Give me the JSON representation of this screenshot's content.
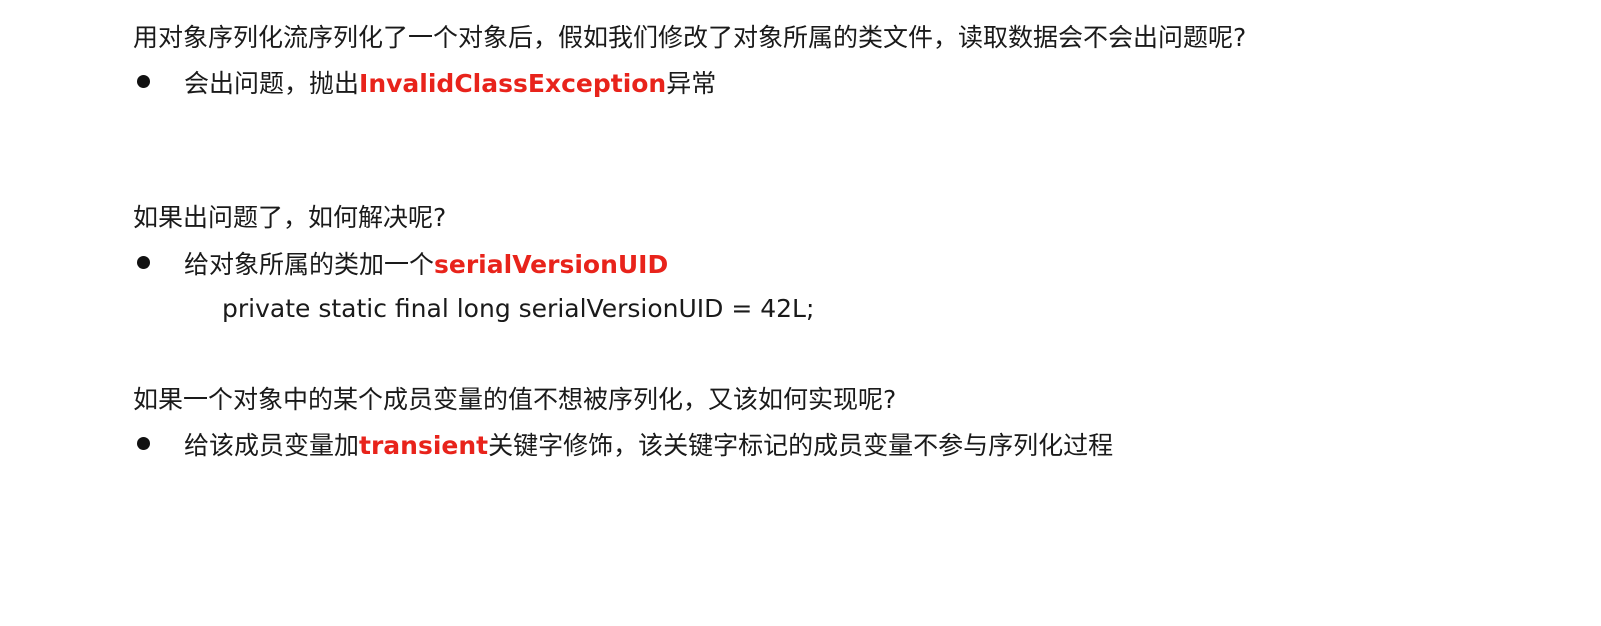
{
  "section1": {
    "question": "用对象序列化流序列化了一个对象后，假如我们修改了对象所属的类文件，读取数据会不会出问题呢?",
    "bullet_pre": "会出问题，抛出",
    "bullet_hl": "InvalidClassException",
    "bullet_post": "异常"
  },
  "section2": {
    "question": "如果出问题了，如何解决呢?",
    "bullet_pre": "给对象所属的类加一个",
    "bullet_hl": "serialVersionUID",
    "code": "private static final long serialVersionUID = 42L;"
  },
  "section3": {
    "question": "如果一个对象中的某个成员变量的值不想被序列化，又该如何实现呢?",
    "bullet_pre": "给该成员变量加",
    "bullet_hl": "transient",
    "bullet_post": "关键字修饰，该关键字标记的成员变量不参与序列化过程"
  },
  "colors": {
    "highlight": "#e8231b",
    "text": "#1a1a1a",
    "background": "#ffffff"
  }
}
